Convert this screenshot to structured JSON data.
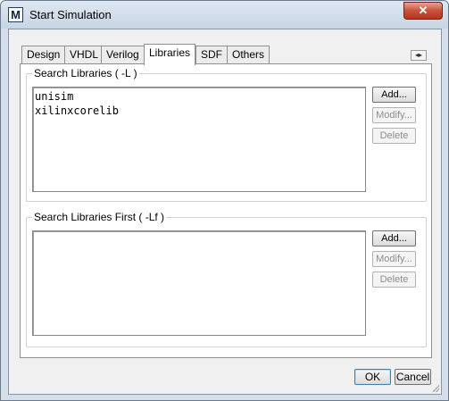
{
  "window": {
    "title": "Start Simulation",
    "app_icon_glyph": "M",
    "close_glyph": "✕"
  },
  "tabs": [
    {
      "label": "Design",
      "active": false
    },
    {
      "label": "VHDL",
      "active": false
    },
    {
      "label": "Verilog",
      "active": false
    },
    {
      "label": "Libraries",
      "active": true
    },
    {
      "label": "SDF",
      "active": false
    },
    {
      "label": "Others",
      "active": false
    }
  ],
  "tab_scroll_glyph": "◂▸",
  "search_libraries": {
    "title": "Search Libraries ( -L )",
    "items": [
      "unisim",
      "xilinxcorelib"
    ],
    "add_label": "Add...",
    "modify_label": "Modify...",
    "delete_label": "Delete"
  },
  "search_libraries_first": {
    "title": "Search Libraries First ( -Lf )",
    "items": [],
    "add_label": "Add...",
    "modify_label": "Modify...",
    "delete_label": "Delete"
  },
  "footer": {
    "ok_label": "OK",
    "cancel_label": "Cancel"
  }
}
